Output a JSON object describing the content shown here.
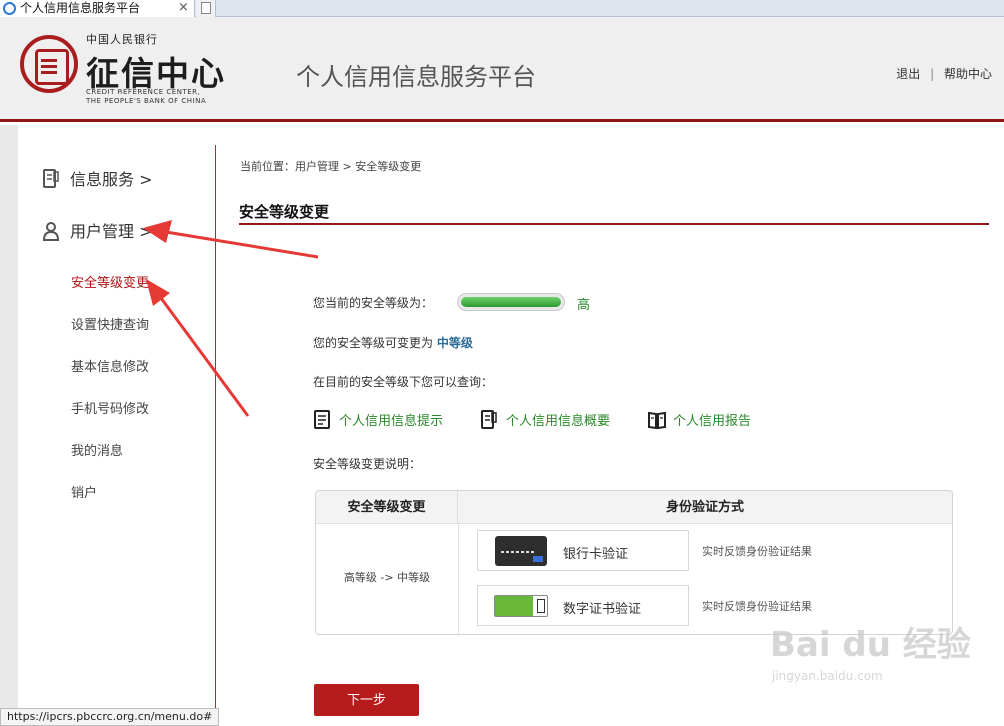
{
  "browser": {
    "tab_title": "个人信用信息服务平台",
    "tab_close": "×",
    "status_url": "https://ipcrs.pbccrc.org.cn/menu.do#"
  },
  "header": {
    "logo_top": "中国人民银行",
    "logo_main": "征信中心",
    "logo_en_line1": "CREDIT REFERENCE CENTER,",
    "logo_en_line2": "THE PEOPLE'S BANK OF CHINA",
    "platform_title": "个人信用信息服务平台",
    "links": {
      "logout": "退出",
      "separator": "|",
      "help": "帮助中心"
    }
  },
  "sidebar": {
    "main_items": [
      {
        "label": "信息服务 >",
        "icon": "document-icon"
      },
      {
        "label": "用户管理 >",
        "icon": "user-icon"
      }
    ],
    "sub_items": [
      {
        "label": "安全等级变更",
        "active": true
      },
      {
        "label": "设置快捷查询"
      },
      {
        "label": "基本信息修改"
      },
      {
        "label": "手机号码修改"
      },
      {
        "label": "我的消息"
      },
      {
        "label": "销户"
      }
    ]
  },
  "main": {
    "breadcrumb": "当前位置：用户管理 > 安全等级变更",
    "title": "安全等级变更",
    "current_level_prefix": "您当前的安全等级为：",
    "current_level": "高",
    "current_level_fill": 1.0,
    "changeable_prefix": "您的安全等级可变更为",
    "changeable_level": "中等级",
    "query_intro": "在目前的安全等级下您可以查询：",
    "query_links": [
      {
        "label": "个人信用信息提示",
        "icon": "document-icon"
      },
      {
        "label": "个人信用信息概要",
        "icon": "document-icon"
      },
      {
        "label": "个人信用报告",
        "icon": "book-icon"
      }
    ],
    "change_desc": "安全等级变更说明：",
    "table": {
      "header_level": "安全等级变更",
      "header_method": "身份验证方式",
      "level_change": "高等级 -> 中等级",
      "methods": [
        {
          "label": "银行卡验证",
          "feedback": "实时反馈身份验证结果",
          "icon": "bank-card-icon"
        },
        {
          "label": "数字证书验证",
          "feedback": "实时反馈身份验证结果",
          "icon": "usb-key-icon"
        }
      ]
    },
    "next_button": "下一步"
  },
  "watermark": {
    "main": "Bai du 经验",
    "sub": "jingyan.baidu.com"
  },
  "colors": {
    "brand_red": "#8e1616",
    "accent_green": "#2a8a2a",
    "button_red": "#b71c1c"
  }
}
